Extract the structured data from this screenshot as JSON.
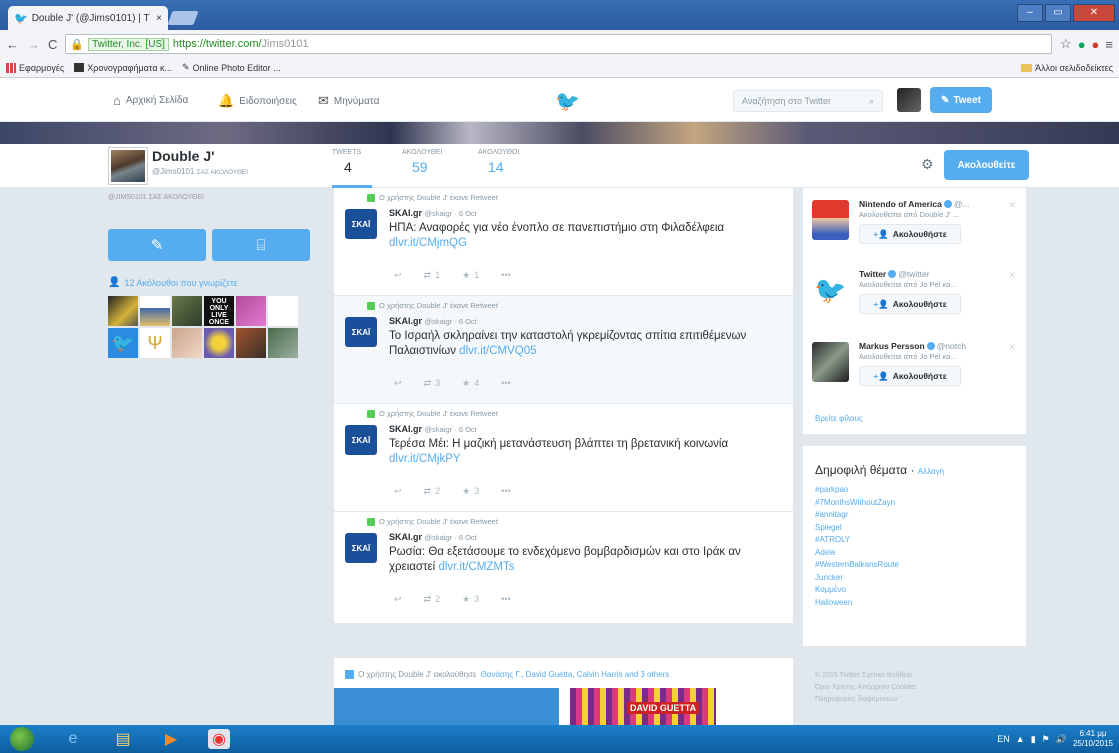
{
  "browser": {
    "tab_title": "Double J' (@Jims0101) | T",
    "tab_close": "×",
    "url_ev": "Twitter, Inc. [US]",
    "url_scheme_host": "https://twitter.com/",
    "url_path": "Jims0101",
    "bookmarks": [
      "Εφαρμογές",
      "Χρονογραφήματα κ...",
      "Online Photo Editor ..."
    ],
    "other_bookmarks": "Άλλοι σελιδοδείκτες"
  },
  "nav": {
    "home": "Αρχική Σελίδα",
    "notifications": "Ειδοποιήσεις",
    "messages": "Μηνύματα",
    "search_placeholder": "Αναζήτηση στο Twitter",
    "tweet_button": "Tweet"
  },
  "profile": {
    "name": "Double J'",
    "handle": "@Jims0101",
    "handle_note": "ΣΑΣ ΑΚΟΛΟΥΘΕΙ",
    "stats": [
      {
        "label": "TWEETS",
        "value": "4"
      },
      {
        "label": "ΑΚΟΛΟΥΘΕΙ",
        "value": "59"
      },
      {
        "label": "ΑΚΟΛΟΥΘΟΙ",
        "value": "14"
      }
    ],
    "follow_button": "Ακολουθείτε",
    "left_muted": "@JIMS0101 ΣΑΣ ΑΚΟΛΟΥΘΕΙ",
    "followers_you_know": "12 Ακόλουθοι που γνωρίζετε"
  },
  "timeline": {
    "tweets": [
      {
        "retweet_line": "Ο χρήστης Double J' έκανε Retweet",
        "author": "SKAI.gr",
        "meta": "@skaigr · 6 Oct",
        "text": "ΗΠΑ: Αναφορές για νέο ένοπλο σε πανεπιστήμιο στη Φιλαδέλφεια",
        "link": "dlvr.it/CMjmQG",
        "retweets": "1",
        "likes": "1"
      },
      {
        "retweet_line": "Ο χρήστης Double J' έκανε Retweet",
        "author": "SKAI.gr",
        "meta": "@skaigr · 6 Oct",
        "text": "Το Ισραήλ σκληραίνει την καταστολή γκρεμίζοντας σπίτια επιτιθέμενων Παλαιστινίων",
        "link": "dlvr.it/CMVQ05",
        "retweets": "3",
        "likes": "4"
      },
      {
        "retweet_line": "Ο χρήστης Double J' έκανε Retweet",
        "author": "SKAI.gr",
        "meta": "@skaigr · 6 Oct",
        "text": "Τερέσα Μέι: Η μαζική μετανάστευση βλάπτει τη βρετανική κοινωνία",
        "link": "dlvr.it/CMjkPY",
        "retweets": "2",
        "likes": "3"
      },
      {
        "retweet_line": "Ο χρήστης Double J' έκανε Retweet",
        "author": "SKAI.gr",
        "meta": "@skaigr · 6 Oct",
        "text": "Ρωσία: Θα εξετάσουμε το ενδεχόμενο βομβαρδισμών και στο Ιράκ αν χρειαστεί",
        "link": "dlvr.it/CMZMTs",
        "retweets": "2",
        "likes": "3"
      }
    ],
    "follow_note_prefix": "Ο χρήστης Double J' ακολούθησε",
    "follow_note_names": "Θανάσης Γ., David Guetta, Calvin Harris and 3 others",
    "card_label": "DAVID GUETTA"
  },
  "who_to_follow": {
    "items": [
      {
        "name": "Nintendo of America",
        "handle": "@...",
        "sub": "Ακολουθείται από Double J' ...",
        "button": "Ακολουθήστε"
      },
      {
        "name": "Twitter",
        "handle": "@twitter",
        "sub": "Ακολουθείται από Jo Pel κα...",
        "button": "Ακολουθήστε"
      },
      {
        "name": "Markus Persson",
        "handle": "@notch",
        "sub": "Ακολουθείται από Jo Pel κα...",
        "button": "Ακολουθήστε"
      }
    ],
    "find_friends": "Βρείτε φίλους"
  },
  "trends": {
    "title": "Δημοφιλή θέματα",
    "change": "Αλλαγή",
    "items": [
      "#parkpao",
      "#7MonthsWithoutZayn",
      "#annitagr",
      "Spiegel",
      "#ATROLY",
      "Adele",
      "#WesternBalkansRoute",
      "Juncker",
      "Κομμένο",
      "Halloween"
    ]
  },
  "footer": {
    "lines": [
      "© 2015 Twitter  Σχετικά  Βοήθεια",
      "Όροι Χρήσης  Απόρρητο  Cookies",
      "Πληροφορίες διαφημίσεων"
    ]
  },
  "taskbar": {
    "lang": "EN",
    "time": "6:41 μμ",
    "date": "25/10/2015"
  }
}
